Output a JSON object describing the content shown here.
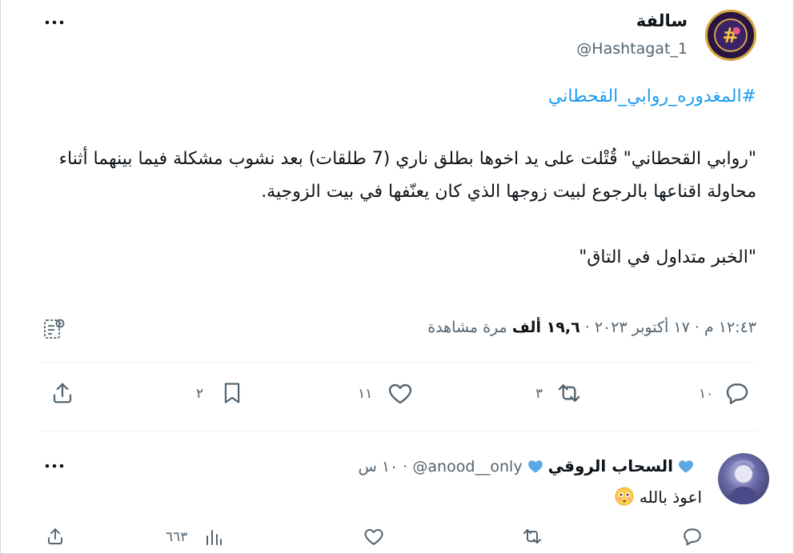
{
  "tweet": {
    "author_name": "سالفة",
    "author_handle": "@Hashtagat_1",
    "hashtag": "#المغدوره_روابي_القحطاني",
    "body": "\"روابي القحطاني\" قُتْلت على يد اخوها بطلق ناري (7 طلقات) بعد نشوب مشكلة فيما بينهما أثناء محاولة اقناعها بالرجوع لبيت زوجها الذي كان يعنّفها في بيت الزوجية.\n\n\"الخبر متداول في التاق\"",
    "time": "١٢:٤٣ م",
    "separator": "·",
    "date": "١٧ أكتوبر ٢٠٢٣",
    "views_count": "١٩,٦ ألف",
    "views_label": "مرة مشاهدة",
    "replies": "١٠",
    "retweets": "٣",
    "likes": "١١",
    "bookmarks": "٢"
  },
  "reply": {
    "name": "السحاب الروقي",
    "handle": "@anood__only",
    "separator": "·",
    "time": "١٠ س",
    "text": "اعوذ بالله",
    "emoji": "😳",
    "views": "٦٦٣"
  },
  "colors": {
    "accent": "#1d9bf0",
    "text": "#0f1419",
    "secondary": "#536471",
    "heart_blue": "#5aa9e6"
  },
  "icons": [
    "more-icon",
    "grok-icon",
    "reply-icon",
    "retweet-icon",
    "like-icon",
    "bookmark-icon",
    "share-icon",
    "views-icon",
    "blue-heart-icon",
    "flushed-face-emoji"
  ]
}
